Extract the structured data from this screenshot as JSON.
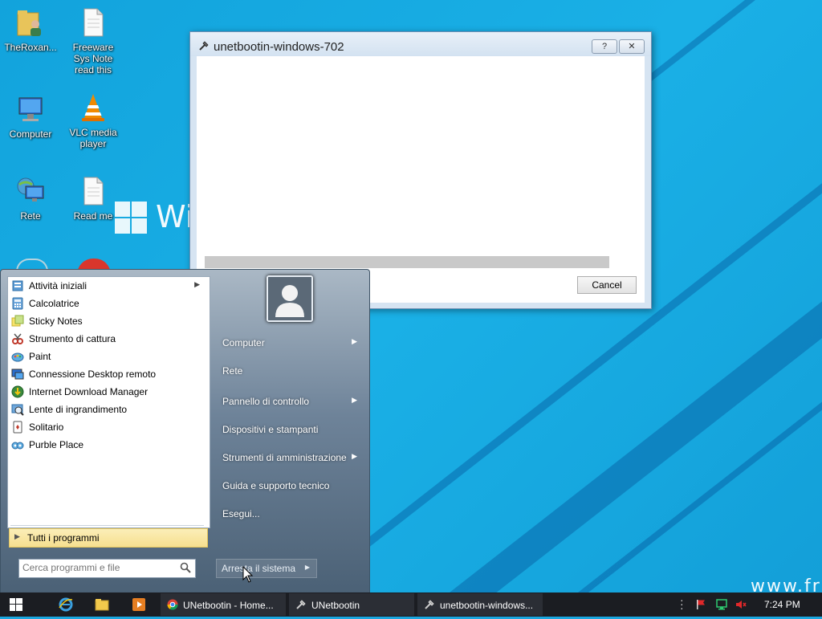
{
  "desktop": {
    "background_brand_text": "Wi",
    "watermark_text": "www.fr",
    "icons": [
      {
        "label": "TheRoxan...",
        "icon": "user-folder-icon"
      },
      {
        "label": "Freeware Sys Note read this",
        "icon": "text-file-icon"
      },
      {
        "label": "Computer",
        "icon": "computer-icon"
      },
      {
        "label": "VLC media player",
        "icon": "vlc-cone-icon"
      },
      {
        "label": "Rete",
        "icon": "network-icon"
      },
      {
        "label": "Read me",
        "icon": "text-file-icon"
      }
    ]
  },
  "dialog": {
    "title": "unetbootin-windows-702",
    "help_button": "?",
    "close_button": "✕",
    "cancel_label": "Cancel",
    "progress_fraction": 0.0
  },
  "start_menu": {
    "programs": [
      {
        "label": "Attività iniziali",
        "icon": "getting-started-icon",
        "has_submenu": true
      },
      {
        "label": "Calcolatrice",
        "icon": "calculator-icon",
        "has_submenu": false
      },
      {
        "label": "Sticky Notes",
        "icon": "sticky-notes-icon",
        "has_submenu": false
      },
      {
        "label": "Strumento di cattura",
        "icon": "snipping-tool-icon",
        "has_submenu": false
      },
      {
        "label": "Paint",
        "icon": "paint-icon",
        "has_submenu": false
      },
      {
        "label": "Connessione Desktop remoto",
        "icon": "remote-desktop-icon",
        "has_submenu": false
      },
      {
        "label": "Internet Download Manager",
        "icon": "idm-icon",
        "has_submenu": false
      },
      {
        "label": "Lente di ingrandimento",
        "icon": "magnifier-icon",
        "has_submenu": false
      },
      {
        "label": "Solitario",
        "icon": "solitaire-icon",
        "has_submenu": false
      },
      {
        "label": "Purble Place",
        "icon": "purble-place-icon",
        "has_submenu": false
      }
    ],
    "all_programs_label": "Tutti i programmi",
    "search_placeholder": "Cerca programmi e file",
    "right_items": [
      {
        "label": "Computer",
        "has_submenu": true
      },
      {
        "label": "Rete",
        "has_submenu": false
      },
      {
        "label": "Pannello di controllo",
        "has_submenu": true
      },
      {
        "label": "Dispositivi e stampanti",
        "has_submenu": false
      },
      {
        "label": "Strumenti di amministrazione",
        "has_submenu": true
      },
      {
        "label": "Guida e supporto tecnico",
        "has_submenu": false
      },
      {
        "label": "Esegui...",
        "has_submenu": false
      }
    ],
    "shutdown_label": "Arresta il sistema"
  },
  "taskbar": {
    "tasks": [
      {
        "label": "UNetbootin - Home...",
        "icon": "chrome-icon"
      },
      {
        "label": "UNetbootin",
        "icon": "unetbootin-icon"
      },
      {
        "label": "unetbootin-windows...",
        "icon": "unetbootin-icon"
      }
    ],
    "clock": "7:24 PM"
  },
  "colors": {
    "desktop_bg": "#1aa6de",
    "taskbar_bg": "#1b1d22",
    "all_programs_highlight": "#f6df8f"
  }
}
